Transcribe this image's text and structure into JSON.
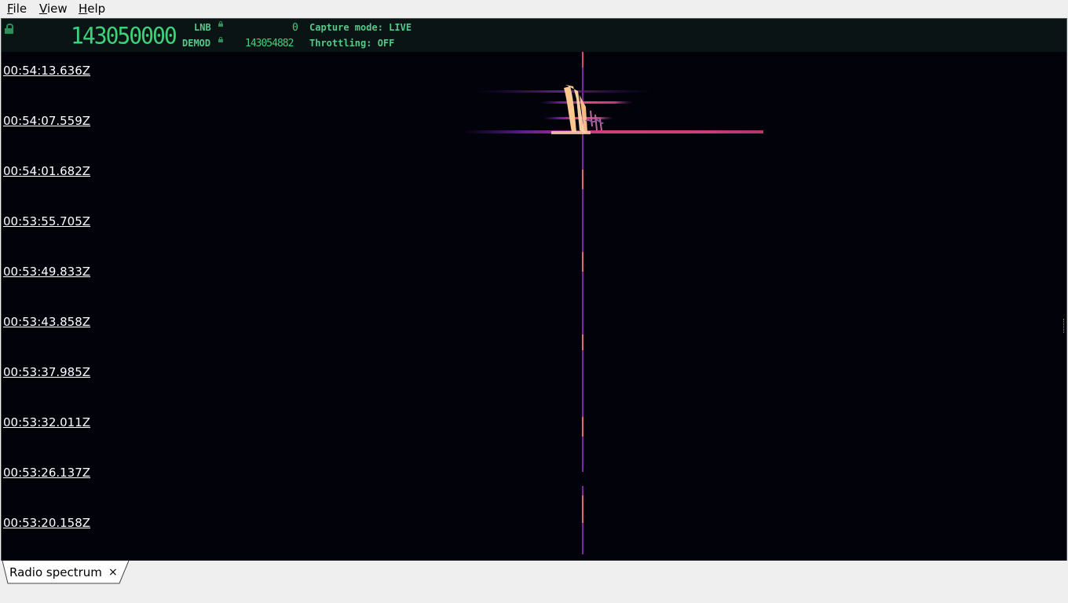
{
  "menu": {
    "file": {
      "mnemonic": "F",
      "rest": "ile"
    },
    "view": {
      "mnemonic": "V",
      "rest": "iew"
    },
    "help": {
      "mnemonic": "H",
      "rest": "elp"
    }
  },
  "status": {
    "frequency_main": "143050000",
    "lnb_label": "LNB",
    "lnb_value": "0",
    "demod_label": "DEMOD",
    "demod_value": "143054882",
    "capture_mode": "Capture mode: LIVE",
    "throttling": "Throttling: OFF"
  },
  "waterfall": {
    "timestamps": [
      "00:54:13.636Z",
      "00:54:07.559Z",
      "00:54:01.682Z",
      "00:53:55.705Z",
      "00:53:49.833Z",
      "00:53:43.858Z",
      "00:53:37.985Z",
      "00:53:32.011Z",
      "00:53:26.137Z",
      "00:53:20.158Z"
    ]
  },
  "tabs": [
    {
      "label": "Radio spectrum",
      "close_glyph": "×"
    }
  ],
  "colors": {
    "waterfall_bg": "#02020a",
    "status_bg": "#0a1414",
    "status_green": "#3fd07a",
    "signal_hot": "#ffd9a8",
    "signal_mid": "#e0457a",
    "signal_low": "#5a1e8c"
  }
}
